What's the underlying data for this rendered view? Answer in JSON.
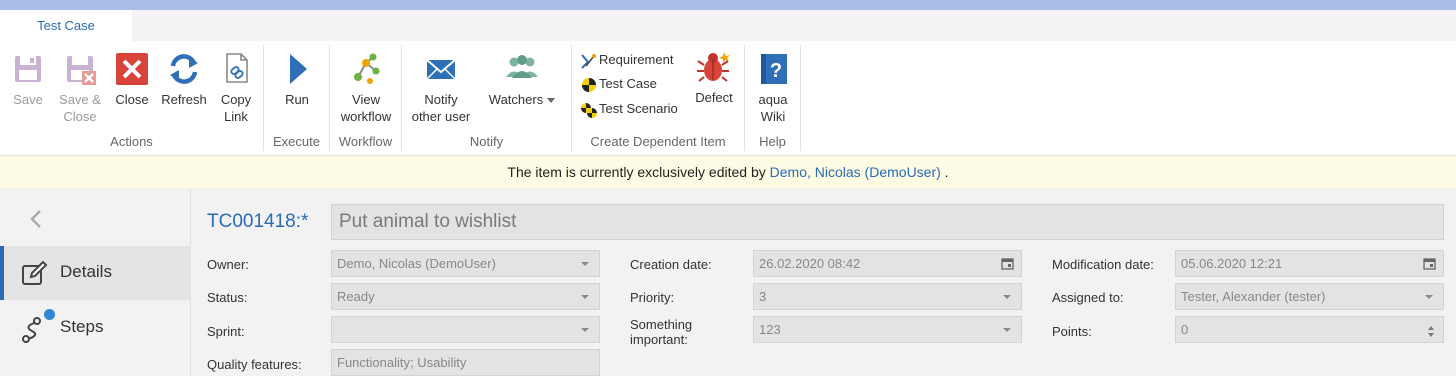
{
  "tab": {
    "label": "Test Case"
  },
  "ribbon": {
    "actions": {
      "group_label": "Actions",
      "save": "Save",
      "save_close": "Save &\nClose",
      "close": "Close",
      "refresh": "Refresh",
      "copy_link": "Copy\nLink"
    },
    "execute": {
      "group_label": "Execute",
      "run": "Run"
    },
    "workflow": {
      "group_label": "Workflow",
      "view_workflow": "View\nworkflow"
    },
    "notify": {
      "group_label": "Notify",
      "notify_other": "Notify\nother user",
      "watchers": "Watchers"
    },
    "create_dependent": {
      "group_label": "Create Dependent Item",
      "requirement": "Requirement",
      "test_case": "Test Case",
      "test_scenario": "Test Scenario",
      "defect": "Defect"
    },
    "help": {
      "group_label": "Help",
      "aqua_wiki": "aqua\nWiki"
    }
  },
  "banner": {
    "text_before": "The item is currently exclusively edited by ",
    "user_link": "Demo, Nicolas (DemoUser)",
    "text_after": " ."
  },
  "sidebar": {
    "items": [
      {
        "label": "Details",
        "icon": "edit-icon",
        "active": true
      },
      {
        "label": "Steps",
        "icon": "steps-icon",
        "active": false
      }
    ]
  },
  "item": {
    "id": "TC001418:*",
    "title": "Put animal to wishlist"
  },
  "fields": {
    "owner": {
      "label": "Owner:",
      "value": "Demo, Nicolas (DemoUser)"
    },
    "status": {
      "label": "Status:",
      "value": "Ready"
    },
    "sprint": {
      "label": "Sprint:",
      "value": ""
    },
    "quality": {
      "label": "Quality features:",
      "value": "Functionality; Usability"
    },
    "creation_date": {
      "label": "Creation date:",
      "value": "26.02.2020 08:42"
    },
    "priority": {
      "label": "Priority:",
      "value": "3"
    },
    "something": {
      "label": "Something\nimportant:",
      "value": "123"
    },
    "modification_date": {
      "label": "Modification date:",
      "value": "05.06.2020 12:21"
    },
    "assigned_to": {
      "label": "Assigned to:",
      "value": "Tester, Alexander (tester)"
    },
    "points": {
      "label": "Points:",
      "value": "0"
    }
  },
  "colors": {
    "accent": "#2a6bb5",
    "banner_bg": "#fdfbe3",
    "close_red": "#d9443a",
    "run_blue": "#2e6fb7"
  }
}
